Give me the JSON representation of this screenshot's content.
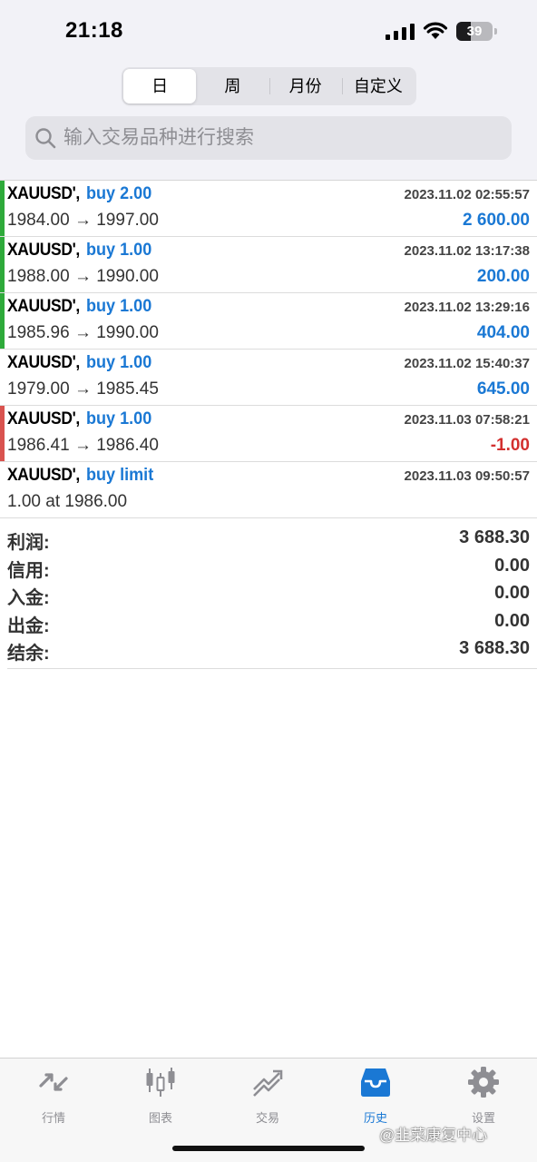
{
  "status_bar": {
    "time": "21:18",
    "battery": "39"
  },
  "period_tabs": [
    {
      "label": "日",
      "active": true
    },
    {
      "label": "周",
      "active": false
    },
    {
      "label": "月份",
      "active": false
    },
    {
      "label": "自定义",
      "active": false
    }
  ],
  "search": {
    "placeholder": "输入交易品种进行搜索",
    "value": ""
  },
  "orders": [
    {
      "symbol": "XAUUSD',",
      "type": "buy 2.00",
      "time": "2023.11.02 02:55:57",
      "prices": "1984.00 → 1997.00",
      "profit": "2 600.00",
      "indicator_color": "#2eaa3a",
      "profit_color": "#1a78d4"
    },
    {
      "symbol": "XAUUSD',",
      "type": "buy 1.00",
      "time": "2023.11.02 13:17:38",
      "prices": "1988.00 → 1990.00",
      "profit": "200.00",
      "indicator_color": "#2eaa3a",
      "profit_color": "#1a78d4"
    },
    {
      "symbol": "XAUUSD',",
      "type": "buy 1.00",
      "time": "2023.11.02 13:29:16",
      "prices": "1985.96 → 1990.00",
      "profit": "404.00",
      "indicator_color": "#2eaa3a",
      "profit_color": "#1a78d4"
    },
    {
      "symbol": "XAUUSD',",
      "type": "buy 1.00",
      "time": "2023.11.02 15:40:37",
      "prices": "1979.00 → 1985.45",
      "profit": "645.00",
      "indicator_color": "",
      "profit_color": "#1a78d4"
    },
    {
      "symbol": "XAUUSD',",
      "type": "buy 1.00",
      "time": "2023.11.03 07:58:21",
      "prices": "1986.41 → 1986.40",
      "profit": "-1.00",
      "indicator_color": "#d9534f",
      "profit_color": "#d3302f"
    },
    {
      "symbol": "XAUUSD',",
      "type": "buy limit",
      "time": "2023.11.03 09:50:57",
      "prices": "1.00 at 1986.00",
      "profit": "",
      "indicator_color": "",
      "profit_color": "#1a78d4"
    }
  ],
  "summary": [
    {
      "label": "利润:",
      "value": "3 688.30"
    },
    {
      "label": "信用:",
      "value": "0.00"
    },
    {
      "label": "入金:",
      "value": "0.00"
    },
    {
      "label": "出金:",
      "value": "0.00"
    },
    {
      "label": "结余:",
      "value": "3 688.30"
    }
  ],
  "tabbar": [
    {
      "label": "行情",
      "icon": "quotes-icon",
      "active": false
    },
    {
      "label": "图表",
      "icon": "chart-icon",
      "active": false
    },
    {
      "label": "交易",
      "icon": "trade-icon",
      "active": false
    },
    {
      "label": "历史",
      "icon": "history-icon",
      "active": true
    },
    {
      "label": "设置",
      "icon": "settings-icon",
      "active": false
    }
  ],
  "colors": {
    "accent": "#1a78d4",
    "profit_positive": "#1a78d4",
    "profit_negative": "#d3302f",
    "inactive_tab": "#8e8e93"
  },
  "watermark": "@韭菜康复中心"
}
